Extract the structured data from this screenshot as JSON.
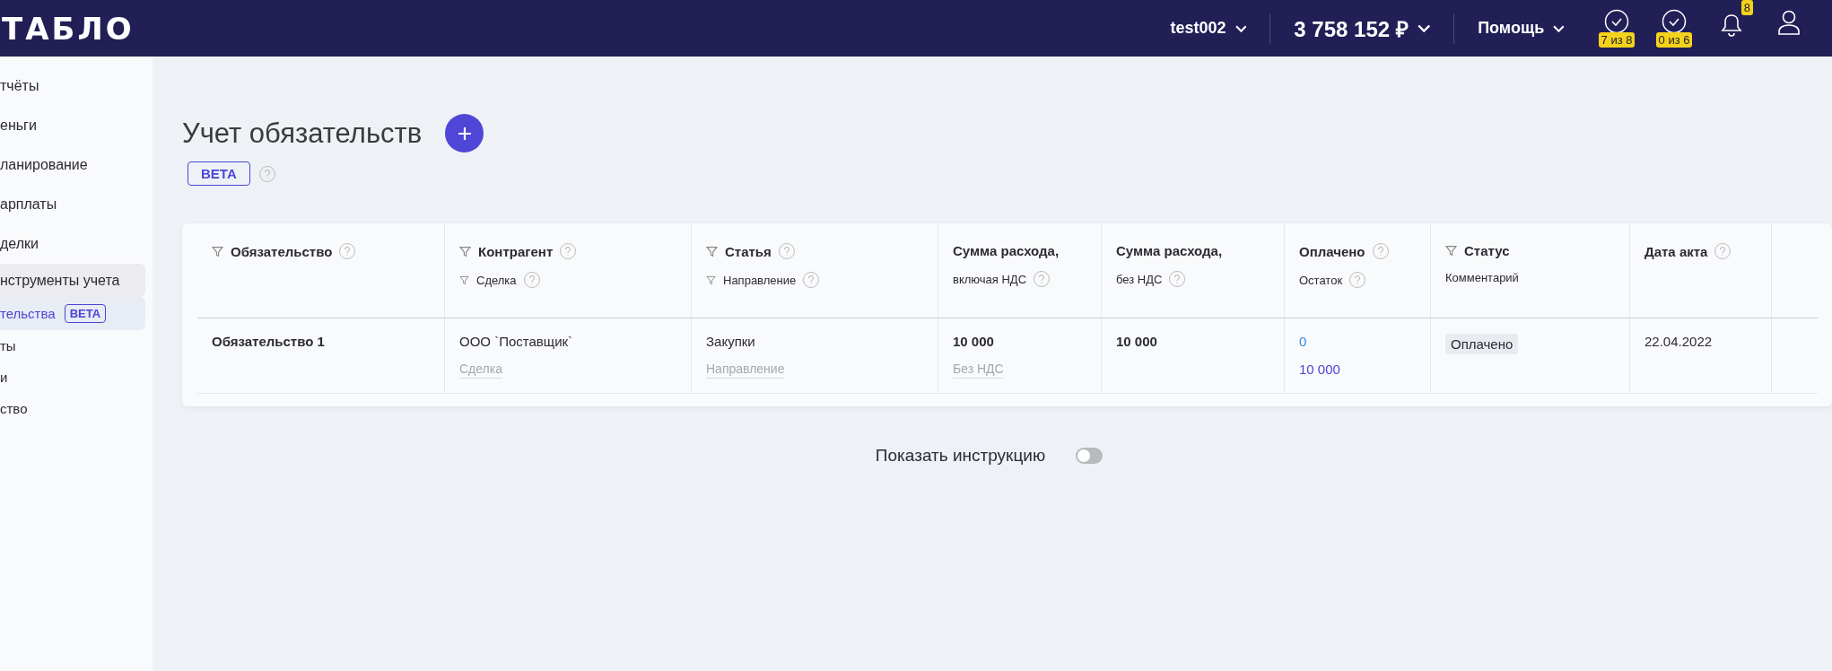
{
  "header": {
    "logo": "ТАБЛО",
    "account": "test002",
    "balance": "3 758 152 ₽",
    "help": "Помощь",
    "tasks": [
      {
        "badge": "7 из 8"
      },
      {
        "badge": "0 из 6"
      }
    ],
    "notifications": "8"
  },
  "sidebar": {
    "items": [
      {
        "label": "тчёты",
        "selected": false
      },
      {
        "label": "еньги",
        "selected": false
      },
      {
        "label": "ланирование",
        "selected": false
      },
      {
        "label": "арплаты",
        "selected": false
      },
      {
        "label": "делки",
        "selected": false
      },
      {
        "label": "нструменты учета",
        "selected": false,
        "expanded": true,
        "children": [
          {
            "label": "тельства",
            "badge": "BETA",
            "selected": true
          },
          {
            "label": "ты",
            "selected": false
          },
          {
            "label": "и",
            "selected": false
          },
          {
            "label": "ство",
            "selected": false
          }
        ]
      }
    ]
  },
  "page": {
    "title": "Учет обязательств",
    "badge": "BETA"
  },
  "table": {
    "columns": [
      {
        "label": "Обязательство",
        "filter": true,
        "help": true
      },
      {
        "label": "Контрагент",
        "filter": true,
        "help": true,
        "sub": {
          "label": "Сделка",
          "filter": true,
          "help": true
        }
      },
      {
        "label": "Статья",
        "filter": true,
        "help": true,
        "sub": {
          "label": "Направление",
          "filter": true,
          "help": true
        }
      },
      {
        "label": "Сумма расхода,",
        "filter": false,
        "help": false,
        "sub": {
          "label": "включая НДС",
          "filter": false,
          "help": true
        }
      },
      {
        "label": "Сумма расхода,",
        "filter": false,
        "help": false,
        "sub": {
          "label": "без НДС",
          "filter": false,
          "help": true
        }
      },
      {
        "label": "Оплачено",
        "filter": false,
        "help": true,
        "sub": {
          "label": "Остаток",
          "filter": false,
          "help": true
        }
      },
      {
        "label": "Статус",
        "filter": true,
        "help": false,
        "sub": {
          "label": "Комментарий",
          "filter": false,
          "help": false
        }
      },
      {
        "label": "Дата акта",
        "filter": false,
        "help": true
      }
    ],
    "rows": [
      {
        "cells": [
          [
            {
              "text": "Обязательство 1",
              "kind": "bold"
            }
          ],
          [
            {
              "text": "ООО `Поставщик`",
              "kind": "plain"
            },
            {
              "text": "Сделка",
              "kind": "placeholder"
            }
          ],
          [
            {
              "text": "Закупки",
              "kind": "plain"
            },
            {
              "text": "Направление",
              "kind": "placeholder"
            }
          ],
          [
            {
              "text": "10 000",
              "kind": "bold"
            },
            {
              "text": "Без НДС",
              "kind": "placeholder"
            }
          ],
          [
            {
              "text": "10 000",
              "kind": "bold"
            }
          ],
          [
            {
              "text": "0",
              "kind": "link"
            },
            {
              "text": "10 000",
              "kind": "accent"
            }
          ],
          [
            {
              "text": "Оплачено",
              "kind": "tag"
            }
          ],
          [
            {
              "text": "22.04.2022",
              "kind": "plain"
            }
          ]
        ]
      }
    ]
  },
  "instruction_toggle": {
    "label": "Показать инструкцию",
    "on": false
  }
}
